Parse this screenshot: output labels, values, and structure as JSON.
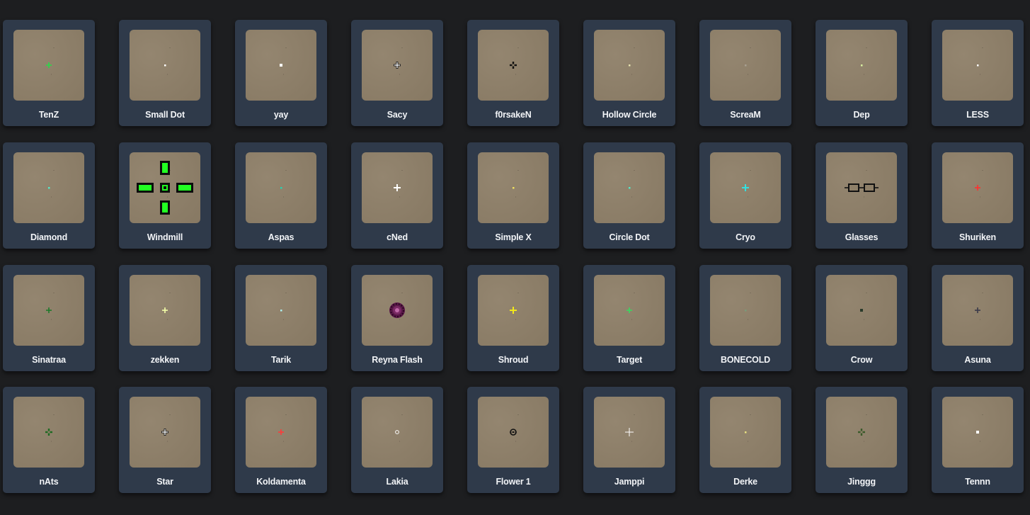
{
  "page": {
    "background": "#1d1e20"
  },
  "card_style": {
    "card_color": "#2f3a4a",
    "thumb_color": "#8e7f68",
    "label_color": "#f2f4f7"
  },
  "crosshairs": [
    {
      "name": "TenZ",
      "style": "plus-small",
      "color": "#2bd84a"
    },
    {
      "name": "Small Dot",
      "style": "dot-tiny",
      "color": "#ffffff"
    },
    {
      "name": "yay",
      "style": "dot",
      "color": "#ffffff"
    },
    {
      "name": "Sacy",
      "style": "plus-outline",
      "color": "#ffffff"
    },
    {
      "name": "f0rsakeN",
      "style": "plus-dark",
      "color": "#111111"
    },
    {
      "name": "Hollow Circle",
      "style": "dot-tiny",
      "color": "#e8e3b0"
    },
    {
      "name": "ScreaM",
      "style": "dot-tiny",
      "color": "#a8a092"
    },
    {
      "name": "Dep",
      "style": "dot-tiny",
      "color": "#d8f0a0"
    },
    {
      "name": "LESS",
      "style": "dot-tiny",
      "color": "#ffffff"
    },
    {
      "name": "Diamond",
      "style": "dot-tiny",
      "color": "#55e8c8"
    },
    {
      "name": "Windmill",
      "style": "windmill",
      "color": "#22ff22"
    },
    {
      "name": "Aspas",
      "style": "dot-tiny",
      "color": "#2ad0b0"
    },
    {
      "name": "cNed",
      "style": "plus",
      "color": "#ffffff"
    },
    {
      "name": "Simple X",
      "style": "dot-tiny",
      "color": "#f0e060"
    },
    {
      "name": "Circle Dot",
      "style": "dot-tiny",
      "color": "#55e8c8"
    },
    {
      "name": "Cryo",
      "style": "plus",
      "color": "#33e0e0"
    },
    {
      "name": "Glasses",
      "style": "glasses",
      "color": "#111111"
    },
    {
      "name": "Shuriken",
      "style": "plus-small",
      "color": "#ff3030"
    },
    {
      "name": "Sinatraa",
      "style": "plus-small",
      "color": "#1e7a2a"
    },
    {
      "name": "zekken",
      "style": "plus-small",
      "color": "#f4ffa8"
    },
    {
      "name": "Tarik",
      "style": "dot-tiny",
      "color": "#aef0f0"
    },
    {
      "name": "Reyna Flash",
      "style": "reyna",
      "color": "#4a0f3a"
    },
    {
      "name": "Shroud",
      "style": "plus",
      "color": "#f2e81a"
    },
    {
      "name": "Target",
      "style": "plus-small",
      "color": "#3ad860"
    },
    {
      "name": "BONECOLD",
      "style": "dot-tiny",
      "color": "#7a9a7a"
    },
    {
      "name": "Crow",
      "style": "dot",
      "color": "#2a3a2a"
    },
    {
      "name": "Asuna",
      "style": "plus-small",
      "color": "#3a3a4a"
    },
    {
      "name": "nAts",
      "style": "plus-dark",
      "color": "#1e6a22"
    },
    {
      "name": "Star",
      "style": "plus-outline",
      "color": "#ffffff"
    },
    {
      "name": "Koldamenta",
      "style": "plus-small",
      "color": "#ff3a3a"
    },
    {
      "name": "Lakia",
      "style": "ring-tiny",
      "color": "#ffffff"
    },
    {
      "name": "Flower 1",
      "style": "flower",
      "color": "#111111"
    },
    {
      "name": "Jamppi",
      "style": "plus-thin",
      "color": "#ffffff"
    },
    {
      "name": "Derke",
      "style": "dot-tiny",
      "color": "#e8e080"
    },
    {
      "name": "Jinggg",
      "style": "plus-dark",
      "color": "#3a5a2a"
    },
    {
      "name": "Tennn",
      "style": "dot",
      "color": "#ffffff"
    }
  ]
}
